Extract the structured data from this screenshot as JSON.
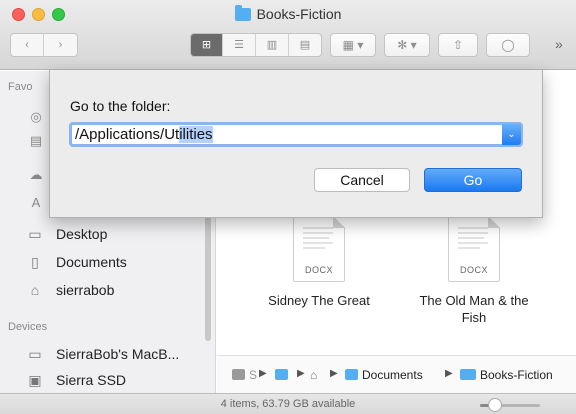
{
  "window": {
    "title": "Books-Fiction"
  },
  "toolbar": {
    "back_icon": "chevron-left-icon",
    "forward_icon": "chevron-right-icon",
    "view_modes": [
      "icon-view-icon",
      "list-view-icon",
      "column-view-icon",
      "cover-flow-icon"
    ],
    "active_view": "icon-view-icon",
    "more_label": "»"
  },
  "sidebar": {
    "favorites_header": "Favo",
    "favorites_icons": [
      "airdrop-icon",
      "drive-icon",
      "icloud-icon",
      "applications-icon"
    ],
    "items": [
      {
        "label": "Desktop",
        "icon": "desktop-icon"
      },
      {
        "label": "Documents",
        "icon": "documents-icon"
      },
      {
        "label": "sierrabob",
        "icon": "home-icon"
      }
    ],
    "devices_header": "Devices",
    "devices": [
      {
        "label": "SierraBob's MacB...",
        "icon": "laptop-icon"
      },
      {
        "label": "Sierra SSD",
        "icon": "disk-icon"
      }
    ]
  },
  "files": [
    {
      "name": "Sidney The Great",
      "ext": "DOCX"
    },
    {
      "name": "The Old Man & the Fish",
      "ext": "DOCX"
    }
  ],
  "pathbar": {
    "crumbs": [
      "S",
      "",
      "",
      "Documents",
      "Books-Fiction"
    ]
  },
  "status": {
    "text": "4 items, 63.79 GB available",
    "icon_size_level": 0.25
  },
  "dialog": {
    "label": "Go to the folder:",
    "input_value_plain": "/Applications/Ut",
    "input_value_selected": "ilities",
    "cancel_label": "Cancel",
    "go_label": "Go"
  },
  "colors": {
    "accent": "#1a79f2",
    "folder": "#54aef2"
  }
}
